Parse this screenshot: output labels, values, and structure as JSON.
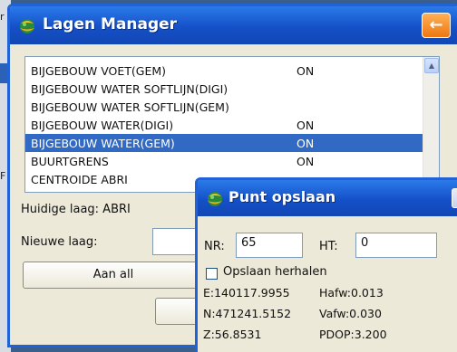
{
  "lagen_manager": {
    "title": "Lagen Manager",
    "back_symbol": "←",
    "layers": [
      {
        "name": "BIJGEBOUW VOET(GEM)",
        "status": "ON",
        "selected": false
      },
      {
        "name": "BIJGEBOUW WATER SOFTLIJN(DIGI)",
        "status": "",
        "selected": false
      },
      {
        "name": "BIJGEBOUW WATER SOFTLIJN(GEM)",
        "status": "",
        "selected": false
      },
      {
        "name": "BIJGEBOUW WATER(DIGI)",
        "status": "ON",
        "selected": false
      },
      {
        "name": "BIJGEBOUW WATER(GEM)",
        "status": "ON",
        "selected": true
      },
      {
        "name": "BUURTGRENS",
        "status": "ON",
        "selected": false
      },
      {
        "name": "CENTROIDE ABRI",
        "status": "",
        "selected": false
      }
    ],
    "huidige_laag_label": "Huidige laag: ABRI",
    "nieuwe_laag_label": "Nieuwe laag:",
    "nieuwe_laag_value": "",
    "aan_all_label": "Aan all",
    "wis_label": "Wi"
  },
  "punt_opslaan": {
    "title": "Punt opslaan",
    "nr_label": "NR:",
    "nr_value": "65",
    "ht_label": "HT:",
    "ht_value": "0",
    "repeat_label": "Opslaan herhalen",
    "repeat_checked": false,
    "e_value": "E:140117.9955",
    "n_value": "N:471241.5152",
    "z_value": "Z:56.8531",
    "hafw_value": "Hafw:0.013",
    "vafw_value": "Vafw:0.030",
    "pdop_value": "PDOP:3.200"
  },
  "desktop": {
    "fragment_1": "r",
    "fragment_2": "F"
  },
  "colors": {
    "title_blue": "#1550c8",
    "selection": "#316ac5",
    "back_orange": "#ee7710"
  }
}
